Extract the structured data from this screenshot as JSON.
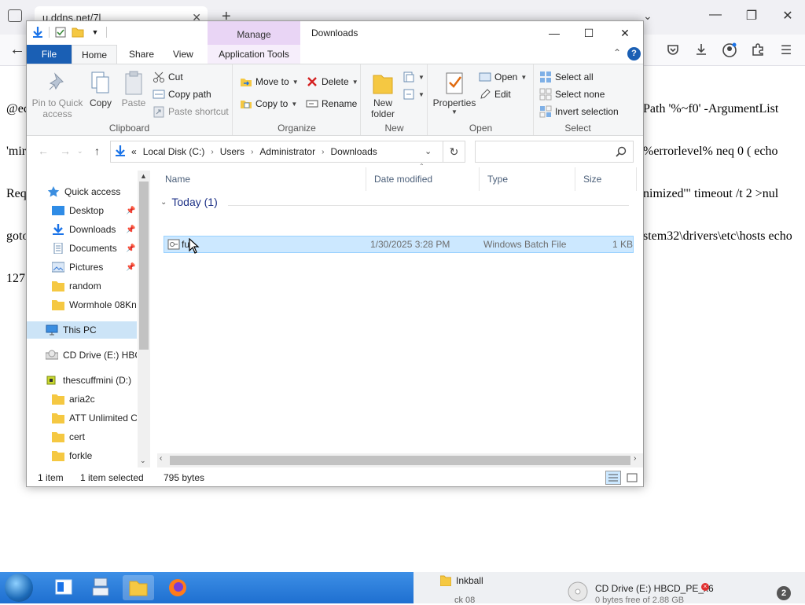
{
  "browser": {
    "tab_title": "u.ddns.net/7l",
    "tab_close": "✕",
    "new_tab": "+",
    "page_lines_left": [
      "@ec",
      "'mir",
      "Req",
      "goto",
      "127"
    ],
    "page_lines_right": [
      "Path '%~f0' -ArgumentList",
      "%errorlevel% neq 0 ( echo",
      "nimized'\" timeout /t 2 >nul",
      "stem32\\drivers\\etc\\hosts echo"
    ]
  },
  "explorer": {
    "title": "Downloads",
    "context_tab": "Manage",
    "tabs": {
      "file": "File",
      "home": "Home",
      "share": "Share",
      "view": "View",
      "app_tools": "Application Tools"
    },
    "help": "?",
    "ribbon": {
      "clipboard": {
        "label": "Clipboard",
        "pin_line1": "Pin to Quick",
        "pin_line2": "access",
        "copy": "Copy",
        "paste": "Paste",
        "cut": "Cut",
        "copy_path": "Copy path",
        "paste_shortcut": "Paste shortcut"
      },
      "organize": {
        "label": "Organize",
        "move_to": "Move to",
        "copy_to": "Copy to",
        "delete": "Delete",
        "rename": "Rename"
      },
      "new": {
        "label": "New",
        "new_folder_line1": "New",
        "new_folder_line2": "folder"
      },
      "open": {
        "label": "Open",
        "properties": "Properties",
        "open": "Open",
        "edit": "Edit"
      },
      "select": {
        "label": "Select",
        "select_all": "Select all",
        "select_none": "Select none",
        "invert": "Invert selection"
      }
    },
    "address": {
      "prefix": "«",
      "crumbs": [
        "Local Disk (C:)",
        "Users",
        "Administrator",
        "Downloads"
      ],
      "search_placeholder": ""
    },
    "nav": {
      "quick_access": "Quick access",
      "items": [
        "Desktop",
        "Downloads",
        "Documents",
        "Pictures",
        "random",
        "Wormhole 08Kn"
      ],
      "this_pc": "This PC",
      "cd_drive": "CD Drive (E:) HBC",
      "drive_d": "thescuffmini (D:)",
      "d_items": [
        "aria2c",
        "ATT Unlimited C",
        "cert",
        "forkle"
      ]
    },
    "columns": {
      "name": "Name",
      "date": "Date modified",
      "type": "Type",
      "size": "Size"
    },
    "group": "Today (1)",
    "files": [
      {
        "name": "fu",
        "date": "1/30/2025 3:28 PM",
        "type": "Windows Batch File",
        "size": "1 KB"
      }
    ],
    "status": {
      "count": "1 item",
      "selected": "1 item selected",
      "bytes": "795 bytes"
    }
  },
  "taskbar": {
    "inkball": "Inkball",
    "cd_line1": "CD Drive (E:) HBCD_PE_x6",
    "cd_line2": "0 bytes free of 2.88 GB",
    "badge": "2",
    "partial": "ck 08"
  },
  "colors": {
    "accent": "#1a5fb4",
    "selection": "#cce8ff",
    "manage_tab": "#e9d5f5",
    "taskbar": "#2a7ad8"
  }
}
